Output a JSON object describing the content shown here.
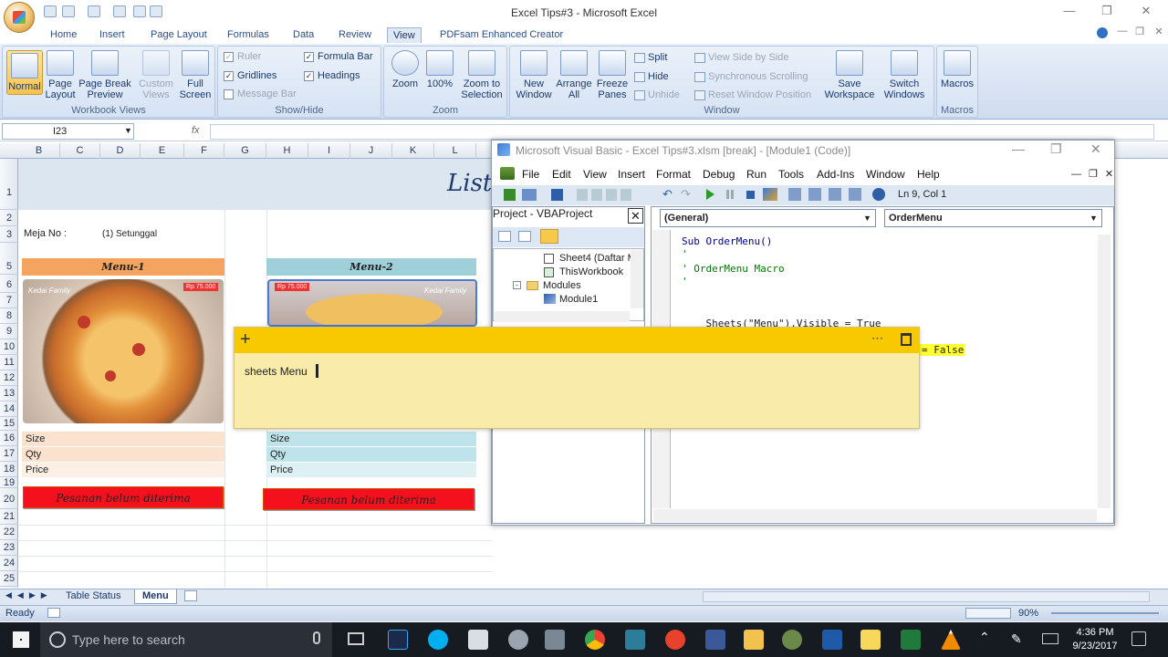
{
  "window": {
    "title": "Excel Tips#3 - Microsoft Excel"
  },
  "ribbon_tabs": [
    "Home",
    "Insert",
    "Page Layout",
    "Formulas",
    "Data",
    "Review",
    "View",
    "PDFsam Enhanced Creator"
  ],
  "active_tab": "View",
  "ribbon": {
    "workbook_views": {
      "label": "Workbook Views",
      "normal": "Normal",
      "page_layout": "Page Layout",
      "page_break": "Page Break Preview",
      "custom": "Custom Views",
      "full": "Full Screen"
    },
    "show_hide": {
      "label": "Show/Hide",
      "ruler": "Ruler",
      "formula_bar": "Formula Bar",
      "gridlines": "Gridlines",
      "headings": "Headings",
      "message_bar": "Message Bar"
    },
    "zoom": {
      "label": "Zoom",
      "zoom": "Zoom",
      "hundred": "100%",
      "zoom_sel": "Zoom to Selection"
    },
    "window": {
      "label": "Window",
      "new_window": "New Window",
      "arrange": "Arrange All",
      "freeze": "Freeze Panes",
      "split": "Split",
      "hide": "Hide",
      "unhide": "Unhide",
      "side": "View Side by Side",
      "sync": "Synchronous Scrolling",
      "reset": "Reset Window Position",
      "save_ws": "Save Workspace",
      "switch": "Switch Windows"
    },
    "macros": {
      "label": "Macros",
      "macros": "Macros"
    }
  },
  "formula_bar": {
    "name_box": "I23",
    "fx": "fx"
  },
  "columns": [
    "B",
    "C",
    "D",
    "E",
    "F",
    "G",
    "H",
    "I",
    "J",
    "K",
    "L"
  ],
  "rows": [
    "1",
    "2",
    "3",
    "5",
    "6",
    "7",
    "8",
    "9",
    "10",
    "11",
    "12",
    "13",
    "14",
    "15",
    "16",
    "17",
    "18",
    "19",
    "20",
    "21",
    "22",
    "23",
    "24",
    "25"
  ],
  "sheet": {
    "list_title": "List",
    "meja_label": "Meja No :",
    "meja_value": "(1) Setunggal",
    "menu1": "Menu-1",
    "menu2": "Menu-2",
    "size": "Size",
    "qty": "Qty",
    "price": "Price",
    "status1": "Pesanan belum diterima",
    "status2": "Pesanan belum diterima",
    "pizza_brand": "Kedai Family",
    "pizza_price1": "Rp 75.000",
    "pizza_price2": "Rp 75.000"
  },
  "sheet_tabs": [
    "Table Status",
    "Menu"
  ],
  "status": {
    "ready": "Ready",
    "zoom": "90%"
  },
  "vba": {
    "title": "Microsoft Visual Basic - Excel Tips#3.xlsm [break] - [Module1 (Code)]",
    "menus": [
      "File",
      "Edit",
      "View",
      "Insert",
      "Format",
      "Debug",
      "Run",
      "Tools",
      "Add-Ins",
      "Window",
      "Help"
    ],
    "position": "Ln 9, Col 1",
    "project_title": "Project - VBAProject",
    "tree": [
      "Sheet4 (Daftar M",
      "ThisWorkbook",
      "Modules",
      "Module1"
    ],
    "combo_left": "(General)",
    "combo_right": "OrderMenu",
    "code_lines": [
      "Sub OrderMenu()",
      "'",
      "' OrderMenu Macro",
      "'",
      "",
      "    Sheets(\"Menu\").Visible = True"
    ],
    "highlight_tail": "= False"
  },
  "sticky": {
    "text": "sheets Menu"
  },
  "taskbar": {
    "search_placeholder": "Type here to search",
    "time": "4:36 PM",
    "date": "9/23/2017"
  }
}
